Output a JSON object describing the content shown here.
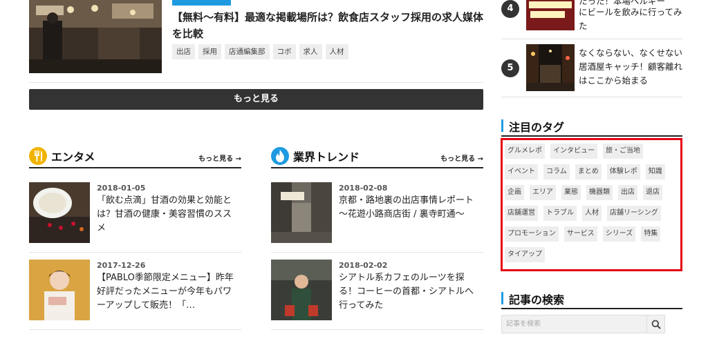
{
  "top_article": {
    "title": "【無料〜有料】最適な掲載場所は？飲食店スタッフ採用の求人媒体を比較",
    "tags": [
      "出店",
      "採用",
      "店通編集部",
      "コボ",
      "求人",
      "人材"
    ]
  },
  "more_button": "もっと見る",
  "sections": [
    {
      "title": "エンタメ",
      "more": "もっと見る →",
      "icon": "fork-knife-icon",
      "icon_color": "#f0b400",
      "articles": [
        {
          "date": "2018-01-05",
          "title": "「飲む点滴」甘酒の効果と効能とは？甘酒の健康・美容習慣のススメ"
        },
        {
          "date": "2017-12-26",
          "title": "【PABLO季節限定メニュー】昨年好評だったメニューが今年もパワーアップして販売！「…"
        }
      ]
    },
    {
      "title": "業界トレンド",
      "more": "もっと見る →",
      "icon": "flame-icon",
      "icon_color": "#1e9be0",
      "articles": [
        {
          "date": "2018-02-08",
          "title": "京都・路地裏の出店事情レポート 〜花遊小路商店街 / 裏寺町通〜"
        },
        {
          "date": "2018-02-02",
          "title": "シアトル系カフェのルーツを探る！コーヒーの首都・シアトルへ行ってみた"
        }
      ]
    }
  ],
  "ranking": [
    {
      "rank": "4",
      "title": "た"
    },
    {
      "rank": "5",
      "title": "なくならない、なくせない居酒屋キャッチ！顧客離れはここから始まる"
    }
  ],
  "ranking_partial": "にビールを飲みに行ってみ",
  "ranking_partial_top": "たった！本場ベルギー",
  "tags_widget": {
    "title": "注目のタグ",
    "tags": [
      "グルメレポ",
      "インタビュー",
      "旅・ご当地",
      "イベント",
      "コラム",
      "まとめ",
      "体験レポ",
      "知識",
      "企画",
      "エリア",
      "業態",
      "機器類",
      "出店",
      "退店",
      "店舗運営",
      "トラブル",
      "人材",
      "店舗リーシング",
      "プロモーション",
      "サービス",
      "シリーズ",
      "特集",
      "タイアップ"
    ]
  },
  "search_widget": {
    "title": "記事の検索",
    "placeholder": "記事を検索"
  },
  "colors": {
    "accent": "#1e9be0",
    "highlight_border": "#e60012",
    "button_bg": "#333333"
  }
}
